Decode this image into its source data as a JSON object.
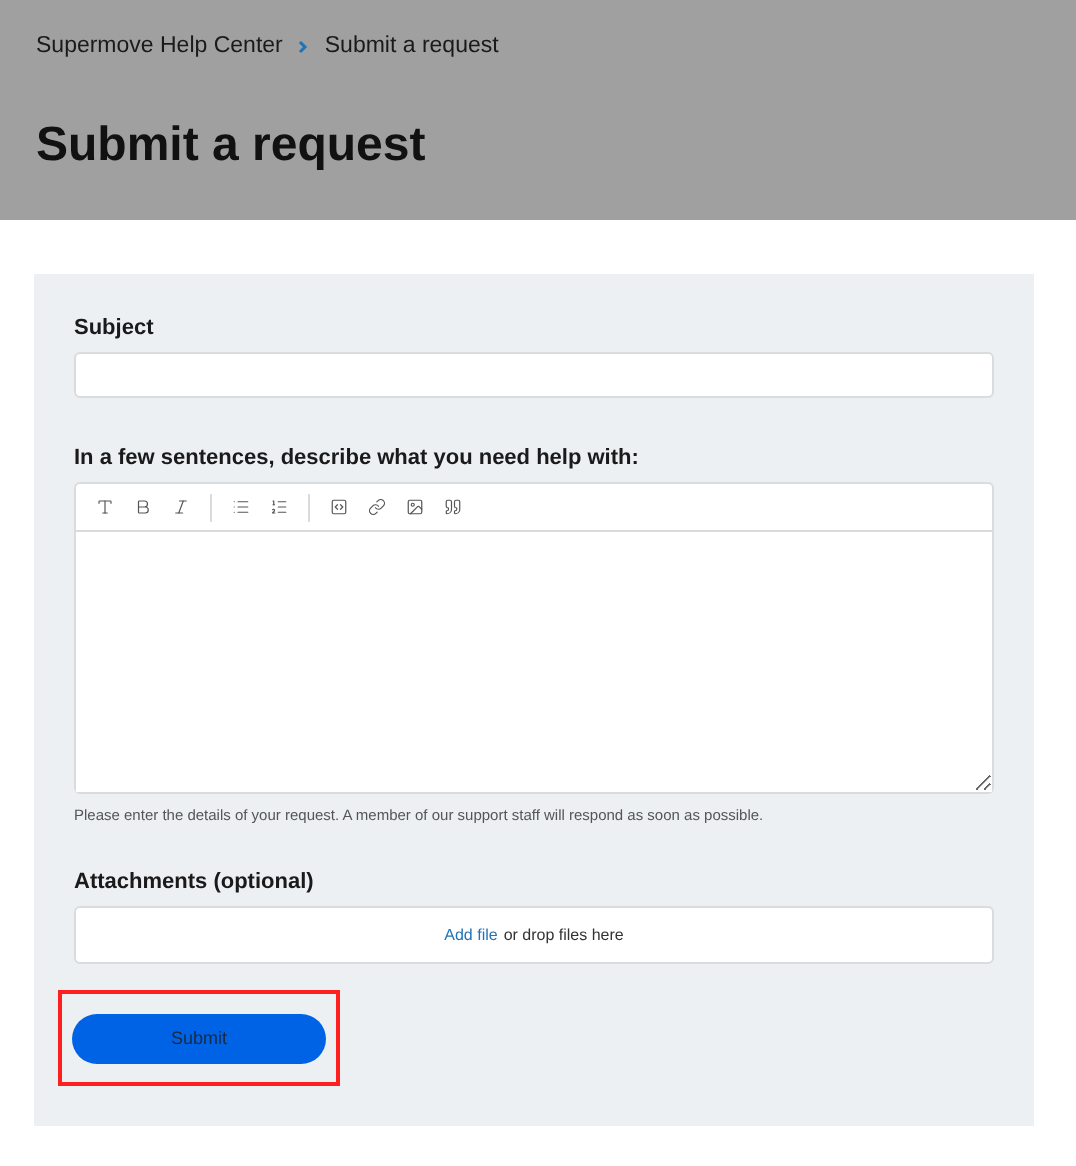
{
  "breadcrumb": [
    {
      "label": "Supermove Help Center"
    },
    {
      "label": "Submit a request"
    }
  ],
  "page_title": "Submit a request",
  "form": {
    "subject_label": "Subject",
    "description_label": "In a few sentences, describe what you need help with:",
    "toolbar": [
      {
        "kind": "text"
      },
      {
        "kind": "bold"
      },
      {
        "kind": "italic"
      },
      {
        "kind": "separator"
      },
      {
        "kind": "bullets"
      },
      {
        "kind": "numbers"
      },
      {
        "kind": "separator"
      },
      {
        "kind": "code"
      },
      {
        "kind": "link"
      },
      {
        "kind": "image"
      },
      {
        "kind": "quote"
      }
    ],
    "hint": "Please enter the details of your request. A member of our support staff will respond as soon as possible.",
    "attachments_label": "Attachments",
    "attachments_note": "(optional)",
    "add_file_link": "Add file",
    "drop_text": "or drop files here",
    "submit": {
      "label": "Submit",
      "highlighted": true
    }
  }
}
